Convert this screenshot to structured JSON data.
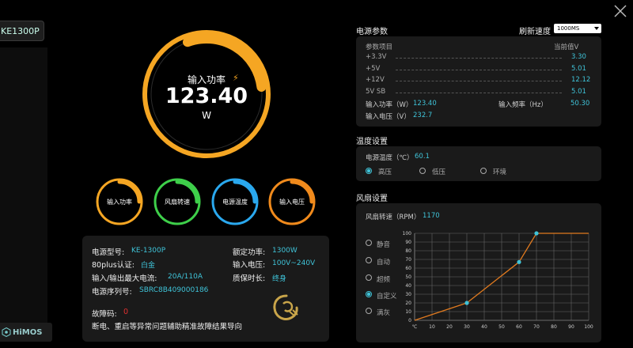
{
  "sidebar": {
    "model_tab": "KE1300P",
    "logo": "HiMOS"
  },
  "gauge": {
    "label": "输入功率",
    "value": "123.40",
    "unit": "W",
    "fill": 0.92
  },
  "small_gauges": [
    {
      "label": "输入功率",
      "color": "#f5a623"
    },
    {
      "label": "风扇转速",
      "color": "#3ecf4a"
    },
    {
      "label": "电源温度",
      "color": "#2aa8ee"
    },
    {
      "label": "输入电压",
      "color": "#f08a1c"
    }
  ],
  "info": {
    "model_label": "电源型号:",
    "model_value": "KE-1300P",
    "rated_label": "额定功率:",
    "rated_value": "1300W",
    "cert_label": "80plus认证:",
    "cert_value": "白金",
    "voltage_label": "输入电压:",
    "voltage_value": "100V~240V",
    "current_label": "输入/输出最大电流:",
    "current_value": "20A/110A",
    "warranty_label": "质保时长:",
    "warranty_value": "终身",
    "serial_label": "电源序列号:",
    "serial_value": "SBRC8B409000186",
    "fault_label": "故障码:",
    "fault_value": "0",
    "fault_desc": "断电、重启等异常问题辅助精准故障结果导向"
  },
  "params": {
    "title": "电源参数",
    "refresh_label": "刷新速度",
    "refresh_value": "1000MS",
    "col_item": "参数项目",
    "col_value": "当前值V",
    "rows": [
      {
        "name": "+3.3V",
        "value": "3.30"
      },
      {
        "name": "+5V",
        "value": "5.01"
      },
      {
        "name": "+12V",
        "value": "12.12"
      },
      {
        "name": "5V SB",
        "value": "5.01"
      }
    ],
    "power_label": "输入功率（W）",
    "power_value": "123.40",
    "freq_label": "输入频率（Hz）",
    "freq_value": "50.30",
    "volt_label": "输入电压（V）",
    "volt_value": "232.7"
  },
  "temp": {
    "title": "温度设置",
    "label": "电源温度（℃）",
    "value": "60.1",
    "options": [
      "高压",
      "低压",
      "环境"
    ],
    "selected": 0
  },
  "fan": {
    "title": "风扇设置",
    "label": "风扇转速（RPM）",
    "value": "1170",
    "modes": [
      "静音",
      "自动",
      "超频",
      "自定义",
      "满灰"
    ],
    "selected_mode": 3
  },
  "chart_data": {
    "type": "line",
    "x": [
      0,
      30,
      60,
      70,
      100
    ],
    "y": [
      0,
      20,
      67,
      100,
      100
    ],
    "control_points": [
      [
        30,
        20
      ],
      [
        60,
        67
      ],
      [
        70,
        100
      ]
    ],
    "xlim": [
      0,
      100
    ],
    "ylim": [
      0,
      100
    ],
    "x_ticks": [
      "℃",
      "10",
      "20",
      "30",
      "40",
      "50",
      "60",
      "70",
      "80",
      "90",
      "100"
    ],
    "y_ticks": [
      "0",
      "10",
      "20",
      "30",
      "40",
      "50",
      "60",
      "70",
      "80",
      "90",
      "100"
    ],
    "grid": true,
    "line_color": "#e07a1f",
    "point_color": "#3fc3d8"
  }
}
